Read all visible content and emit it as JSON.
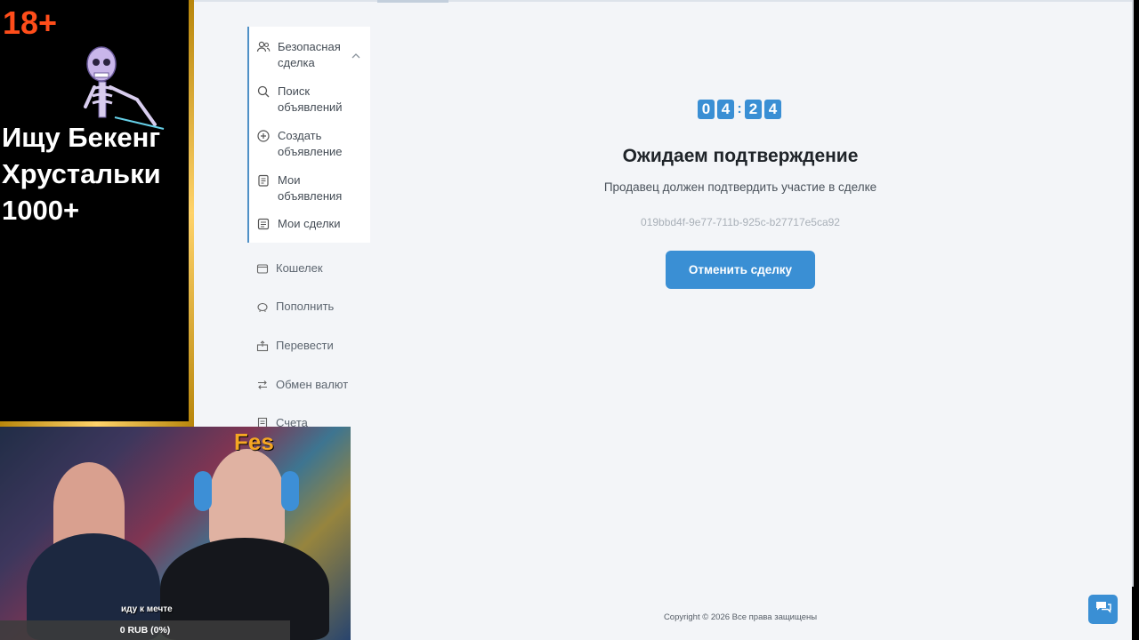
{
  "overlay": {
    "age_badge": "18+",
    "line1": "Ищу Бекенг",
    "line2": "Хрустальки",
    "line3": "1000+"
  },
  "sidebar": {
    "group": {
      "label": "Безопасная сделка",
      "icon": "users-icon"
    },
    "sub_items": [
      {
        "label": "Поиск объявлений",
        "icon": "search-icon"
      },
      {
        "label": "Создать объявление",
        "icon": "plus-circle-icon"
      },
      {
        "label": "Мои объявления",
        "icon": "list-icon"
      },
      {
        "label": "Мои сделки",
        "icon": "deals-icon"
      }
    ],
    "items": [
      {
        "label": "Кошелек",
        "icon": "wallet-icon"
      },
      {
        "label": "Пополнить",
        "icon": "piggy-bank-icon"
      },
      {
        "label": "Перевести",
        "icon": "transfer-icon"
      },
      {
        "label": "Обмен валют",
        "icon": "exchange-icon"
      },
      {
        "label": "Счета",
        "icon": "invoice-icon"
      }
    ]
  },
  "deal": {
    "timer": {
      "m1": "0",
      "m2": "4",
      "s1": "2",
      "s2": "4",
      "separator": ":"
    },
    "title": "Ожидаем подтверждение",
    "subtitle": "Продавец должен подтвердить участие в сделке",
    "deal_id": "019bbd4f-9e77-711b-925c-b27717e5ca92",
    "cancel_label": "Отменить сделку"
  },
  "footer": {
    "copyright": "Copyright © 2026 Все права защищены"
  },
  "webcam": {
    "name": "Fes",
    "caption": "иду к мечте",
    "donation_bar": "0 RUB (0%)"
  },
  "colors": {
    "accent": "#3a8fd4",
    "background": "#f3f5f8"
  }
}
